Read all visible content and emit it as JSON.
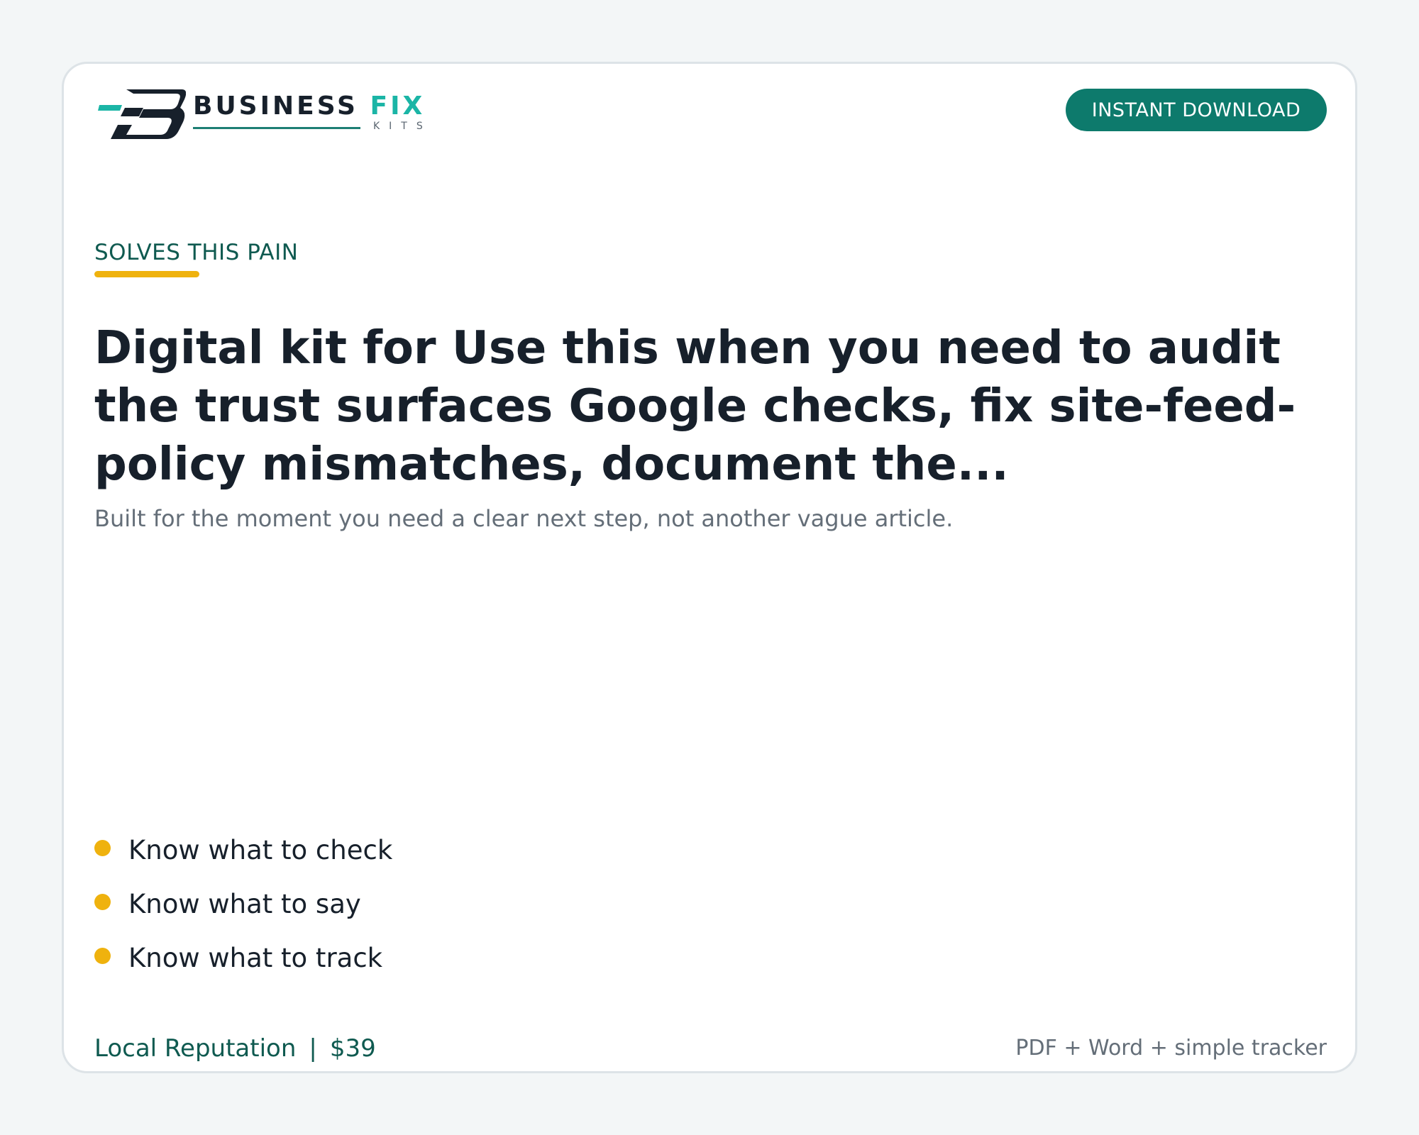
{
  "brand": {
    "name_primary": "BUSINESS",
    "name_accent": "FIX",
    "name_sub": "KITS",
    "logo_icon": "fb-monogram-icon",
    "colors": {
      "dark": "#17202b",
      "teal": "#1bb5a6",
      "green": "#0d7a6c",
      "yellow": "#efb20e"
    }
  },
  "header": {
    "cta_label": "INSTANT DOWNLOAD"
  },
  "hero": {
    "eyebrow": "SOLVES THIS PAIN",
    "headline": "Digital kit for Use this when you need to audit the trust surfaces Google checks, fix site-feed-policy mismatches, document the...",
    "subheadline": "Built for the moment you need a clear next step, not another vague article."
  },
  "benefits": [
    {
      "label": "Know what to check",
      "icon": "bullet-dot-icon"
    },
    {
      "label": "Know what to say",
      "icon": "bullet-dot-icon"
    },
    {
      "label": "Know what to track",
      "icon": "bullet-dot-icon"
    }
  ],
  "footer": {
    "category": "Local Reputation",
    "separator": "|",
    "price": "$39",
    "formats": "PDF + Word + simple tracker"
  }
}
